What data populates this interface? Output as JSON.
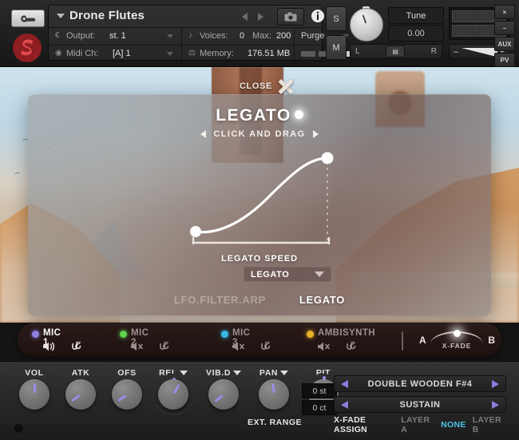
{
  "header": {
    "wrench_icon": "wrench-icon",
    "logo": "spitfire-s-logo",
    "instrument_name": "Drone Flutes",
    "prev_icon": "prev-arrow-icon",
    "next_icon": "next-arrow-icon",
    "camera_icon": "camera-icon",
    "info_icon": "info-icon",
    "output_label": "Output:",
    "output_value": "st. 1",
    "midi_label": "Midi Ch:",
    "midi_value": "[A] 1",
    "voices_label": "Voices:",
    "voices_value": "0",
    "max_label": "Max:",
    "max_value": "200",
    "memory_label": "Memory:",
    "memory_value": "176.51 MB",
    "purge_label": "Purge",
    "solo_label": "S",
    "mute_label": "M",
    "tune_label": "Tune",
    "tune_value": "0.00",
    "pan_left": "L",
    "pan_right": "R",
    "vol_minus": "–",
    "vol_plus": "+",
    "win_close": "×",
    "win_min": "–",
    "win_aux": "AUX",
    "win_pv": "PV"
  },
  "overlay": {
    "close_label": "CLOSE",
    "close_icon": "close-x-icon"
  },
  "panel": {
    "title": "LEGATO",
    "title_dot": "active-dot-indicator",
    "subtitle": "CLICK AND DRAG",
    "arrow_left_icon": "triangle-left-icon",
    "arrow_right_icon": "triangle-right-icon",
    "speed_label": "LEGATO SPEED",
    "speed_value": "LEGATO",
    "speed_caret_icon": "chevron-down-icon",
    "tabs": [
      {
        "label": "LFO.FILTER.ARP",
        "active": false
      },
      {
        "label": "LEGATO",
        "active": true
      }
    ]
  },
  "curve": {
    "start_point": {
      "x": 0.0,
      "y": 0.08
    },
    "end_point": {
      "x": 1.0,
      "y": 0.92
    },
    "handle_icon": "curve-handle-dot"
  },
  "mics": [
    {
      "name": "MIC 1",
      "color": "#8f7fe0",
      "active": true,
      "speaker_icon": "speaker-on-icon",
      "link_icon": "link-icon"
    },
    {
      "name": "MIC 2",
      "color": "#5dd24b",
      "active": false,
      "speaker_icon": "speaker-mute-icon",
      "link_icon": "link-icon"
    },
    {
      "name": "MIC 3",
      "color": "#38b6e6",
      "active": false,
      "speaker_icon": "speaker-mute-icon",
      "link_icon": "link-icon"
    },
    {
      "name": "AMBISYNTH",
      "color": "#e8b12a",
      "active": false,
      "speaker_icon": "speaker-mute-icon",
      "link_icon": "link-icon"
    }
  ],
  "xfade": {
    "left_label": "A",
    "right_label": "B",
    "label": "X-FADE"
  },
  "knobs": [
    {
      "label": "VOL",
      "angle": 0,
      "has_caret": false,
      "double": false
    },
    {
      "label": "ATK",
      "angle": -125,
      "has_caret": false,
      "double": false
    },
    {
      "label": "OFS",
      "angle": -125,
      "has_caret": false,
      "double": false
    },
    {
      "label": "REL",
      "angle": 28,
      "has_caret": true,
      "double": true
    },
    {
      "label": "VIB.D",
      "angle": -128,
      "has_caret": true,
      "double": false
    },
    {
      "label": "PAN",
      "angle": -8,
      "has_caret": true,
      "double": false
    },
    {
      "label": "PIT",
      "angle": 0,
      "has_caret": false,
      "double": true
    }
  ],
  "pitch": {
    "semitones": "0 st",
    "cents": "0 ct",
    "ext_range_label": "EXT. RANGE"
  },
  "presets": {
    "articulation": "DOUBLE WOODEN F#4",
    "variation": "SUSTAIN",
    "prev_icon": "preset-prev-arrow-icon",
    "next_icon": "preset-next-arrow-icon"
  },
  "xfade_assign": {
    "caption": "X-FADE ASSIGN",
    "options": [
      {
        "label": "LAYER A",
        "selected": false
      },
      {
        "label": "NONE",
        "selected": true
      },
      {
        "label": "LAYER B",
        "selected": false
      }
    ]
  },
  "colors": {
    "accent_purple": "#8c7ddd",
    "accent_cyan": "#49c3e6",
    "panel_white": "#ffffff"
  }
}
